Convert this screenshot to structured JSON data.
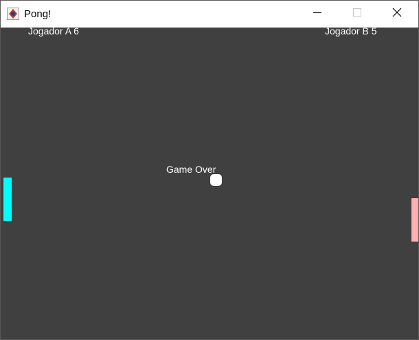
{
  "window": {
    "title": "Pong!",
    "app_icon": "java-app-icon",
    "controls": {
      "minimize_icon": "minimize-icon",
      "maximize_icon": "maximize-icon",
      "close_icon": "close-icon"
    }
  },
  "game": {
    "background_color": "#404040",
    "score_a": "Jogador A 6",
    "score_b": "Jogador B 5",
    "status": "Game Over",
    "paddle_left_color": "#00ffff",
    "paddle_right_color": "#ffafaf",
    "ball_color": "#ffffff"
  }
}
